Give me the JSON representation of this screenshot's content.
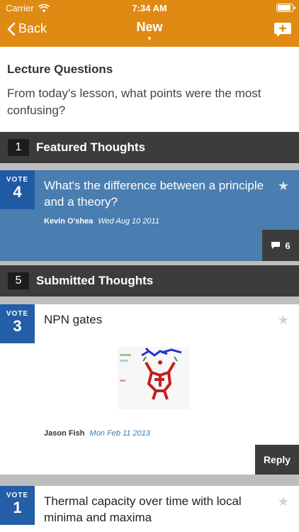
{
  "status_bar": {
    "carrier": "Carrier",
    "time": "7:34 AM",
    "battery_level": 0.95
  },
  "nav": {
    "back_label": "Back",
    "title": "New"
  },
  "question": {
    "title": "Lecture Questions",
    "text": "From today's lesson, what points were the most confusing?"
  },
  "featured_section": {
    "count": "1",
    "label": "Featured Thoughts"
  },
  "submitted_section": {
    "count": "5",
    "label": "Submitted Thoughts"
  },
  "vote_label": "VOTE",
  "featured_thoughts": [
    {
      "votes": "4",
      "title": "What's the difference between a principle and a theory?",
      "author": "Kevin O'shea",
      "date": "Wed Aug 10 2011",
      "comments": "6"
    }
  ],
  "submitted_thoughts": [
    {
      "votes": "3",
      "title": "NPN gates",
      "author": "Jason Fish",
      "date": "Mon Feb 11 2013",
      "action": "Reply"
    },
    {
      "votes": "1",
      "title": "Thermal capacity over time with local minima and maxima"
    }
  ],
  "colors": {
    "nav_orange": "#df8a12",
    "vote_blue": "#235ea7",
    "featured_bg": "#4a7db0",
    "dark_bar": "#3c3c3c"
  },
  "icons": [
    "wifi-icon",
    "chevron-left-icon",
    "compose-icon",
    "star-icon",
    "comment-icon",
    "caret-down-icon"
  ]
}
